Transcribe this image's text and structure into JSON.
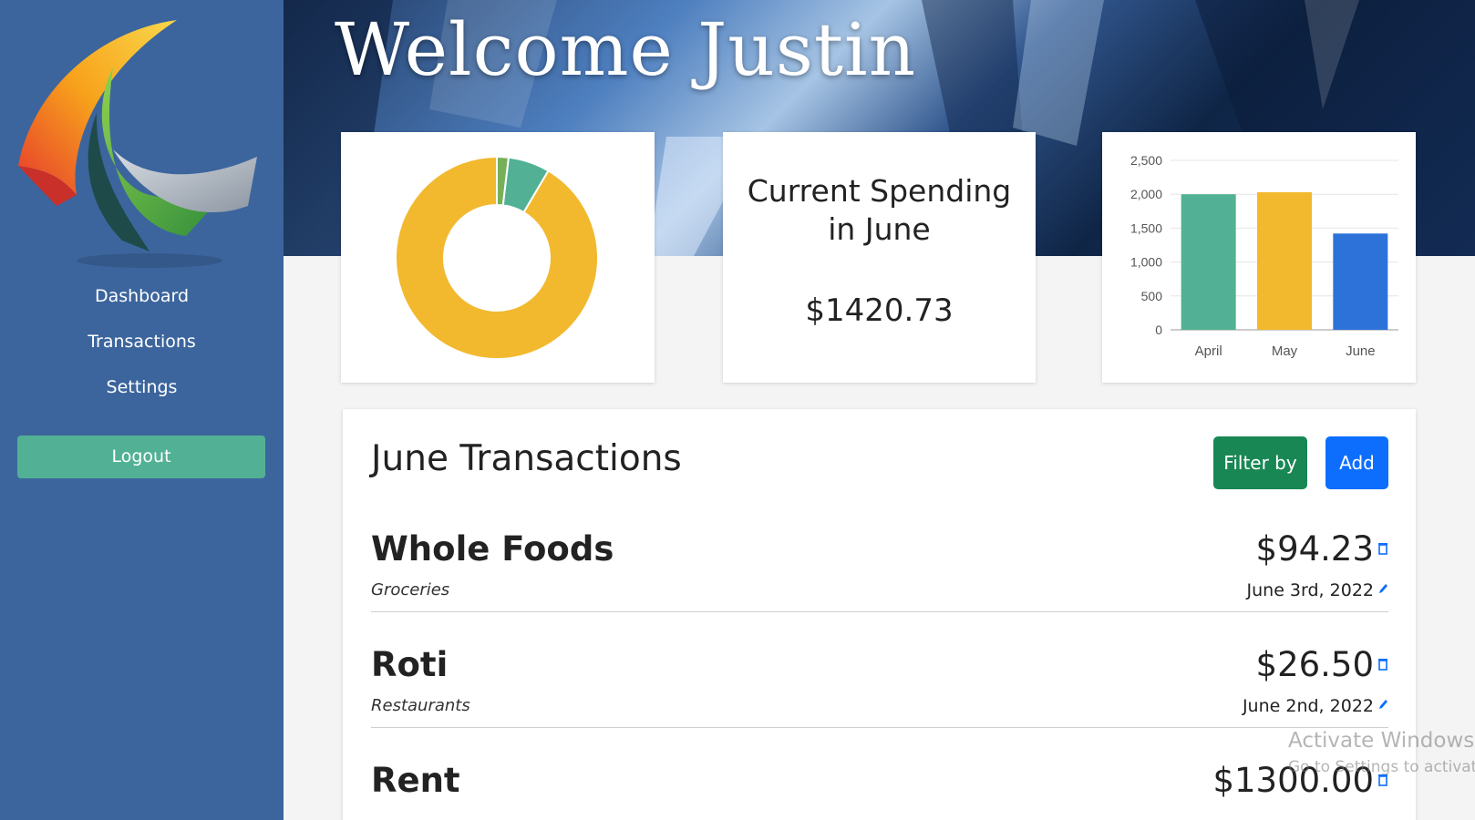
{
  "header": {
    "welcome": "Welcome Justin"
  },
  "sidebar": {
    "items": [
      {
        "label": "Dashboard"
      },
      {
        "label": "Transactions"
      },
      {
        "label": "Settings"
      }
    ],
    "logout_label": "Logout"
  },
  "spending": {
    "title_line1": "Current Spending",
    "title_line2": "in June",
    "amount": "$1420.73"
  },
  "donut_chart": {
    "type": "pie",
    "slices": [
      {
        "value": 26.5,
        "color": "#52b194"
      },
      {
        "value": 94.23,
        "color": "#52b194"
      },
      {
        "value": 1300.0,
        "color": "#f2b92f"
      }
    ],
    "note_colors": [
      "#78b05a",
      "#52b194",
      "#f2b92f"
    ]
  },
  "chart_data": {
    "type": "bar",
    "categories": [
      "April",
      "May",
      "June"
    ],
    "values": [
      2000,
      2030,
      1420.73
    ],
    "colors": [
      "#52b194",
      "#f2b92f",
      "#2c72d8"
    ],
    "yticks": [
      "0",
      "500",
      "1,000",
      "1,500",
      "2,000",
      "2,500"
    ],
    "ylim": [
      0,
      2500
    ],
    "grid": true
  },
  "transactions": {
    "title": "June Transactions",
    "filter_label": "Filter by",
    "add_label": "Add",
    "rows": [
      {
        "name": "Whole Foods",
        "category": "Groceries",
        "amount": "$94.23",
        "date": "June 3rd, 2022"
      },
      {
        "name": "Roti",
        "category": "Restaurants",
        "amount": "$26.50",
        "date": "June 2nd, 2022"
      },
      {
        "name": "Rent",
        "category": "",
        "amount": "$1300.00",
        "date": ""
      }
    ]
  },
  "watermark": {
    "line1": "Activate Windows",
    "line2": "Go to Settings to activate"
  },
  "colors": {
    "sidebar": "#3c659d",
    "accent_green": "#52b194",
    "filter_green": "#198754",
    "add_blue": "#0d6efd"
  }
}
